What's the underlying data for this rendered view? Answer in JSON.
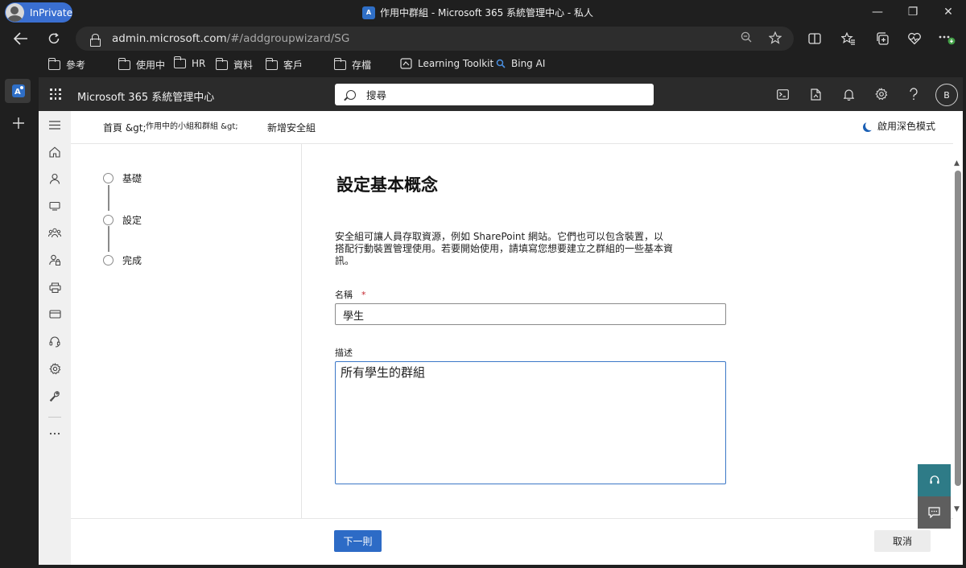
{
  "browser": {
    "inprivate_label": "InPrivate",
    "window_title": "作用中群組 - Microsoft 365 系統管理中心 - 私人",
    "favicon_text": "A",
    "controls": {
      "minimize": "—",
      "restore": "❐",
      "close": "✕"
    },
    "url_host": "admin.microsoft.com",
    "url_path": "/#/addgroupwizard/SG",
    "favorites": [
      {
        "label": "參考",
        "icon": "folder-icon"
      },
      {
        "label": "使用中",
        "icon": "folder-icon"
      },
      {
        "label": "HR",
        "icon": "folder-icon"
      },
      {
        "label": "資料",
        "icon": "folder-icon"
      },
      {
        "label": "客戶",
        "icon": "folder-icon"
      },
      {
        "label": "存檔",
        "icon": "folder-icon"
      },
      {
        "label": "Learning Toolkit",
        "icon": "toolkit-icon"
      },
      {
        "label": "Bing AI",
        "icon": "bing-search-icon"
      }
    ]
  },
  "header": {
    "app_title": "Microsoft 365 系統管理中心",
    "search_placeholder": "搜尋",
    "avatar_initial": "B"
  },
  "breadcrumb": {
    "home": "首頁 &gt;",
    "groups": "作用中的小組和群組 &gt;",
    "current": "新增安全組"
  },
  "darkmode_label": "啟用深色模式",
  "steps": [
    {
      "label": "基礎"
    },
    {
      "label": "設定"
    },
    {
      "label": "完成"
    }
  ],
  "form": {
    "title": "設定基本概念",
    "description_line1": "安全組可讓人員存取資源，例如 SharePoint 網站。它們也可以包含裝置，以",
    "description_line2": "搭配行動裝置管理使用。若要開始使用，請填寫您想要建立之群組的一些基本資訊。",
    "name_label": "名稱",
    "required_mark": "*",
    "name_value": "學生",
    "desc_label": "描述",
    "desc_value": "所有學生的群組"
  },
  "buttons": {
    "next": "下一則",
    "cancel": "取消"
  },
  "colors": {
    "primary_button": "#2d6bc6",
    "fab_support": "#2e7b87",
    "fab_feedback": "#5e5e5e"
  }
}
